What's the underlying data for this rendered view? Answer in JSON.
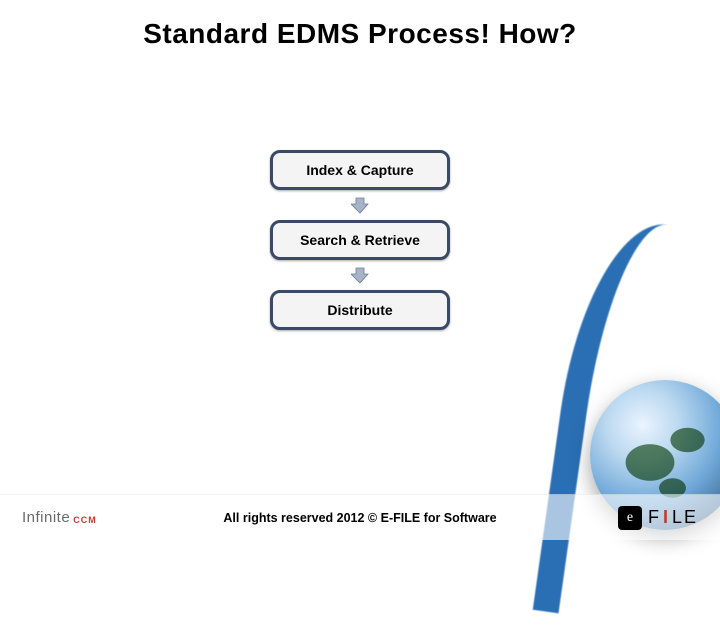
{
  "title": "Standard EDMS Process! How?",
  "flow": {
    "nodes": [
      {
        "label": "Index & Capture"
      },
      {
        "label": "Search & Retrieve"
      },
      {
        "label": "Distribute"
      }
    ]
  },
  "footer": {
    "left_logo": {
      "main": "Infinite",
      "sub": "CCM"
    },
    "copyright": "All rights reserved 2012 © E-FILE for Software",
    "right_logo": {
      "box": "e",
      "text_left": "F",
      "text_right": "LE"
    }
  }
}
